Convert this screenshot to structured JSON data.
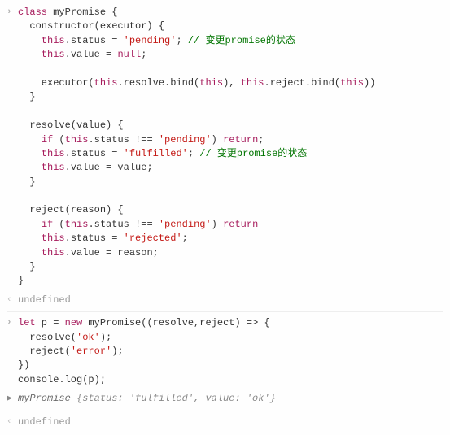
{
  "entries": [
    {
      "gutter": "in",
      "kind": "code",
      "tokens": [
        {
          "t": "class",
          "c": "kw"
        },
        {
          "t": " myPromise {\n  constructor(executor) {\n    "
        },
        {
          "t": "this",
          "c": "kw"
        },
        {
          "t": ".status = "
        },
        {
          "t": "'pending'",
          "c": "str"
        },
        {
          "t": "; "
        },
        {
          "t": "// 变更promise的状态",
          "c": "cmt"
        },
        {
          "t": "\n    "
        },
        {
          "t": "this",
          "c": "kw"
        },
        {
          "t": ".value = "
        },
        {
          "t": "null",
          "c": "kw"
        },
        {
          "t": ";\n\n    executor("
        },
        {
          "t": "this",
          "c": "kw"
        },
        {
          "t": ".resolve.bind("
        },
        {
          "t": "this",
          "c": "kw"
        },
        {
          "t": "), "
        },
        {
          "t": "this",
          "c": "kw"
        },
        {
          "t": ".reject.bind("
        },
        {
          "t": "this",
          "c": "kw"
        },
        {
          "t": "))\n  }\n\n  resolve(value) {\n    "
        },
        {
          "t": "if",
          "c": "kw"
        },
        {
          "t": " ("
        },
        {
          "t": "this",
          "c": "kw"
        },
        {
          "t": ".status !== "
        },
        {
          "t": "'pending'",
          "c": "str"
        },
        {
          "t": ") "
        },
        {
          "t": "return",
          "c": "kw"
        },
        {
          "t": ";\n    "
        },
        {
          "t": "this",
          "c": "kw"
        },
        {
          "t": ".status = "
        },
        {
          "t": "'fulfilled'",
          "c": "str"
        },
        {
          "t": "; "
        },
        {
          "t": "// 变更promise的状态",
          "c": "cmt"
        },
        {
          "t": "\n    "
        },
        {
          "t": "this",
          "c": "kw"
        },
        {
          "t": ".value = value;\n  }\n\n  reject(reason) {\n    "
        },
        {
          "t": "if",
          "c": "kw"
        },
        {
          "t": " ("
        },
        {
          "t": "this",
          "c": "kw"
        },
        {
          "t": ".status !== "
        },
        {
          "t": "'pending'",
          "c": "str"
        },
        {
          "t": ") "
        },
        {
          "t": "return",
          "c": "kw"
        },
        {
          "t": "\n    "
        },
        {
          "t": "this",
          "c": "kw"
        },
        {
          "t": ".status = "
        },
        {
          "t": "'rejected'",
          "c": "str"
        },
        {
          "t": ";\n    "
        },
        {
          "t": "this",
          "c": "kw"
        },
        {
          "t": ".value = reason;\n  }\n}"
        }
      ]
    },
    {
      "gutter": "out",
      "kind": "undef",
      "text": "undefined"
    },
    {
      "sep": true,
      "gutter": "in",
      "kind": "code",
      "tokens": [
        {
          "t": "let",
          "c": "kw"
        },
        {
          "t": " p = "
        },
        {
          "t": "new",
          "c": "kw"
        },
        {
          "t": " myPromise((resolve,reject) => {\n  resolve("
        },
        {
          "t": "'ok'",
          "c": "str"
        },
        {
          "t": ");\n  reject("
        },
        {
          "t": "'error'",
          "c": "str"
        },
        {
          "t": ");\n})\nconsole.log(p);"
        }
      ]
    },
    {
      "gutter": "expand",
      "indent": true,
      "kind": "object",
      "name": "myPromise",
      "preview": " {status: 'fulfilled', value: 'ok'}"
    },
    {
      "sep": true,
      "gutter": "out",
      "kind": "undef",
      "text": "undefined"
    }
  ]
}
